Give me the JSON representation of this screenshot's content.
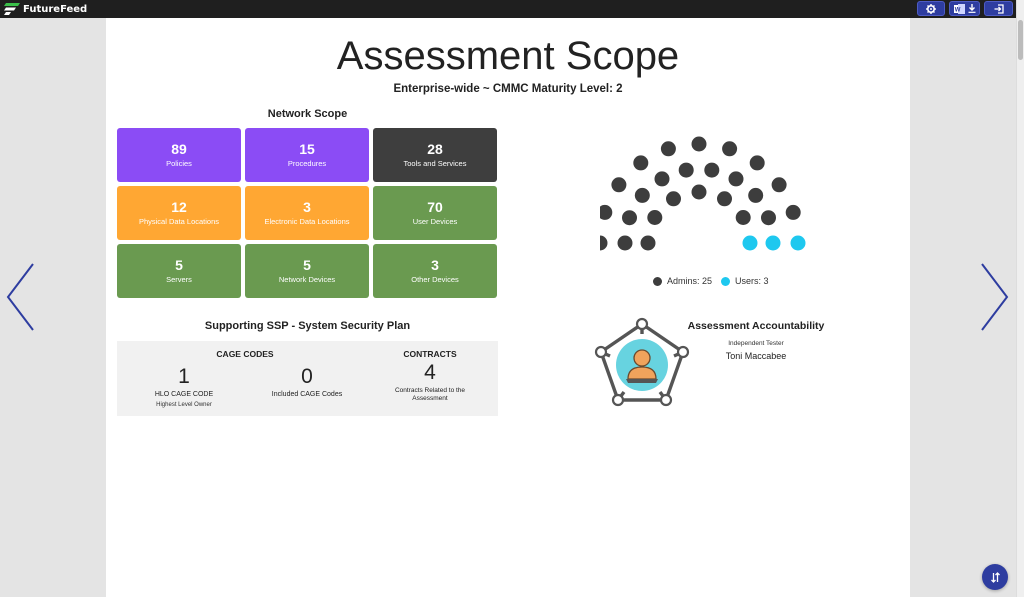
{
  "app": {
    "brand": "FutureFeed",
    "toolbar": {
      "settings_icon": "gear-icon",
      "export_icon": "word-download-icon",
      "exit_icon": "sign-out-icon"
    }
  },
  "slide": {
    "title": "Assessment Scope",
    "subtitle": "Enterprise-wide ~ CMMC Maturity Level: 2"
  },
  "network_scope": {
    "heading": "Network Scope",
    "tiles": [
      {
        "value": "89",
        "label": "Policies",
        "color": "#8b4cf5"
      },
      {
        "value": "15",
        "label": "Procedures",
        "color": "#8b4cf5"
      },
      {
        "value": "28",
        "label": "Tools and Services",
        "color": "#3e3e3e"
      },
      {
        "value": "12",
        "label": "Physical Data Locations",
        "color": "#ffa733"
      },
      {
        "value": "3",
        "label": "Electronic Data Locations",
        "color": "#ffa733"
      },
      {
        "value": "70",
        "label": "User Devices",
        "color": "#6a9a50"
      },
      {
        "value": "5",
        "label": "Servers",
        "color": "#6a9a50"
      },
      {
        "value": "5",
        "label": "Network Devices",
        "color": "#6a9a50"
      },
      {
        "value": "3",
        "label": "Other Devices",
        "color": "#6a9a50"
      }
    ]
  },
  "ssp": {
    "heading": "Supporting SSP - System Security Plan",
    "cage_codes_heading": "CAGE CODES",
    "contracts_heading": "CONTRACTS",
    "hlo_value": "1",
    "hlo_label": "HLO CAGE CODE",
    "hlo_sublabel": "Highest Level Owner",
    "included_value": "0",
    "included_label": "Included CAGE Codes",
    "contracts_value": "4",
    "contracts_label": "Contracts Related to the Assessment"
  },
  "people": {
    "admins_label": "Admins: 25",
    "users_label": "Users: 3",
    "admins": 25,
    "users": 3,
    "admin_color": "#3d3d3d",
    "user_color": "#1ec8ef"
  },
  "accountability": {
    "heading": "Assessment Accountability",
    "role": "Independent Tester",
    "name": "Toni Maccabee"
  },
  "colors": {
    "accent": "#2e3da0",
    "avatar_bg": "#67d3e0",
    "avatar_figure": "#f0a35c"
  }
}
